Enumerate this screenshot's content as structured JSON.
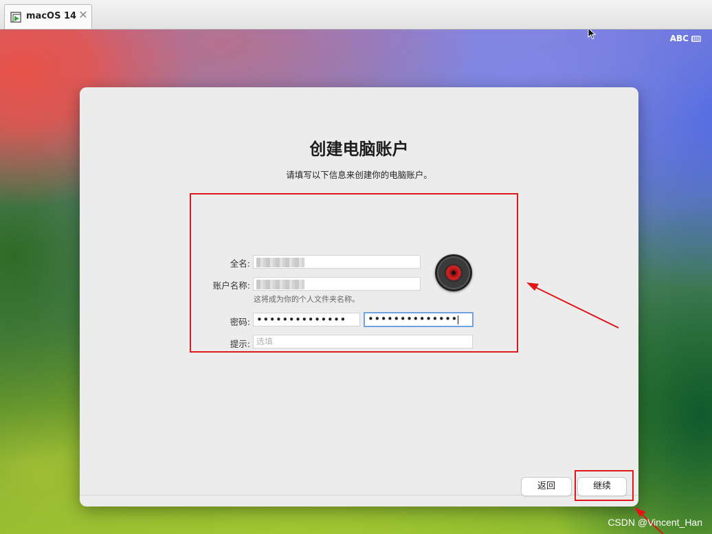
{
  "tab": {
    "label": "macOS 14",
    "close": "✕"
  },
  "menubar": {
    "input_source": "ABC"
  },
  "dialog": {
    "title": "创建电脑账户",
    "subtitle": "请填写以下信息来创建你的电脑账户。",
    "full_name": {
      "label": "全名:"
    },
    "account_name": {
      "label": "账户名称:",
      "hint": "这将成为你的个人文件夹名称。"
    },
    "password": {
      "label": "密码:",
      "value": "••••••••••••••",
      "verify_value": "••••••••••••••"
    },
    "hint": {
      "label": "提示:",
      "placeholder": "选填"
    },
    "back_button": "返回",
    "continue_button": "继续"
  },
  "annotations": {
    "color": "#e01616",
    "watermark": "CSDN @Vincent_Han"
  },
  "icons": [
    "vm-icon",
    "close-icon",
    "keyboard-icon",
    "pointer-cursor-icon",
    "avatar-record-icon",
    "arrow-annotation-icon"
  ]
}
